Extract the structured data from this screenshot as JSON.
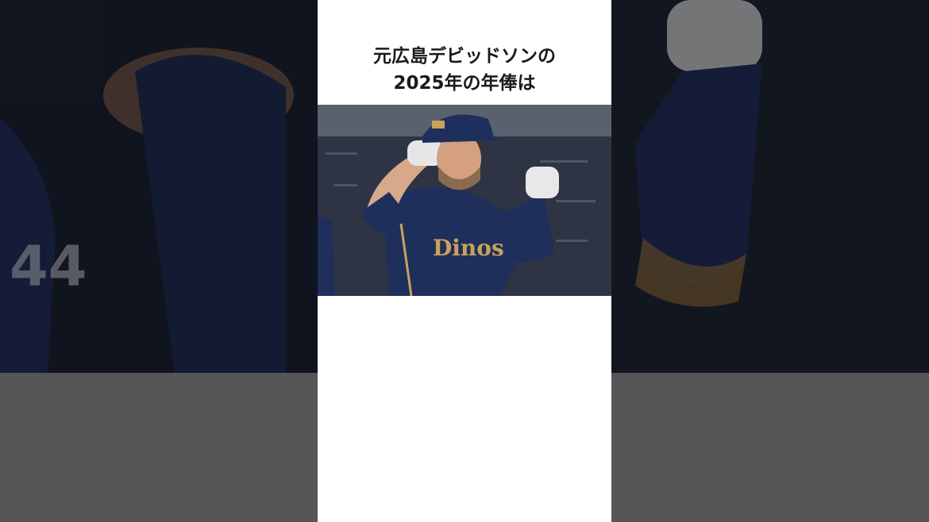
{
  "video": {
    "title_line1": "元広島デビッドソンの",
    "title_line2": "2025年の年俸は"
  },
  "photo": {
    "subject": "baseball player in navy Dinos uniform raising both fists",
    "jersey_text": "Dinos",
    "colors": {
      "uniform": "#1f2f5c",
      "trim": "#c8a15a",
      "card_bg": "#ffffff",
      "side_bg": "#1c2236"
    }
  }
}
